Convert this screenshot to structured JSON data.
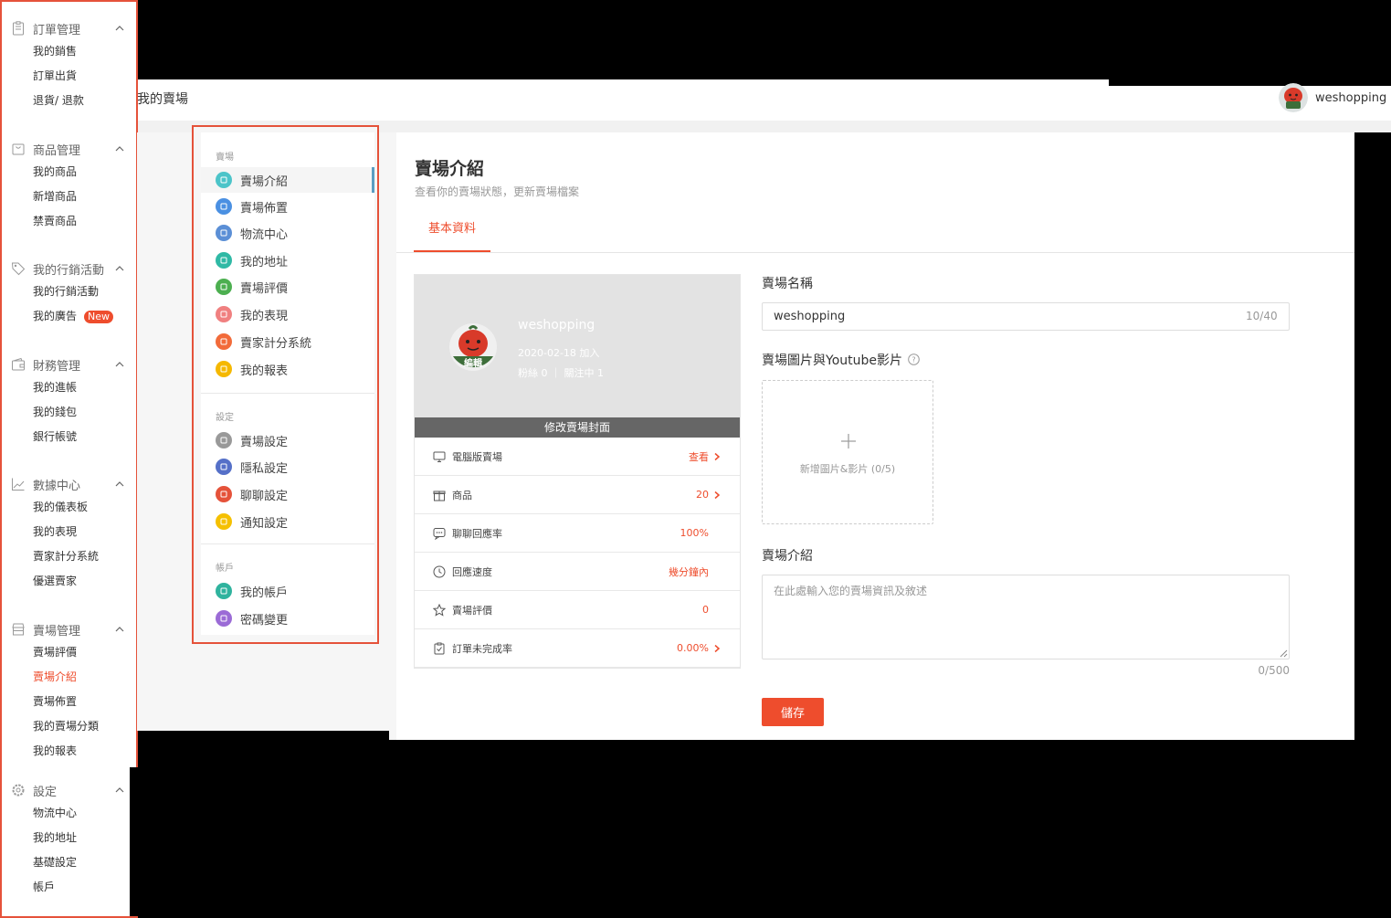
{
  "header": {
    "breadcrumb": "我的賣場",
    "username": "weshopping"
  },
  "left_nav": {
    "groups": [
      {
        "title": "訂單管理",
        "icon": "clipboard-icon",
        "items": [
          "我的銷售",
          "訂單出貨",
          "退貨/ 退款"
        ]
      },
      {
        "title": "商品管理",
        "icon": "bag-icon",
        "items": [
          "我的商品",
          "新增商品",
          "禁賣商品"
        ]
      },
      {
        "title": "我的行銷活動",
        "icon": "tag-icon",
        "items": [
          "我的行銷活動",
          "我的廣告"
        ]
      },
      {
        "title": "財務管理",
        "icon": "wallet-icon",
        "items": [
          "我的進帳",
          "我的錢包",
          "銀行帳號"
        ]
      },
      {
        "title": "數據中心",
        "icon": "chart-line-icon",
        "items": [
          "我的儀表板",
          "我的表現",
          "賣家計分系統",
          "優選賣家"
        ]
      },
      {
        "title": "賣場管理",
        "icon": "store-icon",
        "items": [
          "賣場評價",
          "賣場介紹",
          "賣場佈置",
          "我的賣場分類",
          "我的報表"
        ]
      },
      {
        "title": "設定",
        "icon": "gear-icon",
        "items": [
          "物流中心",
          "我的地址",
          "基礎設定",
          "帳戶"
        ]
      }
    ],
    "new_badge": "New",
    "active_item": "賣場介紹"
  },
  "settings_nav": {
    "sections": [
      {
        "label": "賣場",
        "items": [
          "賣場介紹",
          "賣場佈置",
          "物流中心",
          "我的地址",
          "賣場評價",
          "我的表現",
          "賣家計分系統",
          "我的報表"
        ]
      },
      {
        "label": "設定",
        "items": [
          "賣場設定",
          "隱私設定",
          "聊聊設定",
          "通知設定"
        ]
      },
      {
        "label": "帳戶",
        "items": [
          "我的帳戶",
          "密碼變更"
        ]
      }
    ],
    "icon_colors": {
      "賣場介紹": "#4cc4c9",
      "賣場佈置": "#4a90e2",
      "物流中心": "#5b8fd6",
      "我的地址": "#2fb9a5",
      "賣場評價": "#4caf50",
      "我的表現": "#f08080",
      "賣家計分系統": "#f26b3a",
      "我的報表": "#f5b800",
      "賣場設定": "#999999",
      "隱私設定": "#5570c8",
      "聊聊設定": "#e5523a",
      "通知設定": "#f5c000",
      "我的帳戶": "#2fb39e",
      "密碼變更": "#9b6bd6"
    }
  },
  "main": {
    "title": "賣場介紹",
    "subtitle": "查看你的賣場狀態，更新賣場檔案",
    "tab": "基本資料",
    "cover": {
      "shop_name": "weshopping",
      "joined": "2020-02-18 加入",
      "stats": "粉絲 0 ｜ 關注中 1",
      "avatar_label": "編輯",
      "edit_cover_button": "修改賣場封面"
    },
    "stats": [
      {
        "label": "電腦版賣場",
        "value": "查看",
        "icon": "monitor-icon",
        "has_arrow": true
      },
      {
        "label": "商品",
        "value": "20",
        "icon": "gift-box-icon",
        "has_arrow": true
      },
      {
        "label": "聊聊回應率",
        "value": "100%",
        "icon": "chat-bubble-icon",
        "has_arrow": false
      },
      {
        "label": "回應速度",
        "value": "幾分鐘內",
        "icon": "clock-icon",
        "has_arrow": false
      },
      {
        "label": "賣場評價",
        "value": "0",
        "icon": "star-icon",
        "has_arrow": false
      },
      {
        "label": "訂單未完成率",
        "value": "0.00%",
        "icon": "clipboard-check-icon",
        "has_arrow": true
      }
    ],
    "form": {
      "shop_name_label": "賣場名稱",
      "shop_name_value": "weshopping",
      "shop_name_count": "10/40",
      "media_label": "賣場圖片與Youtube影片",
      "media_upload_text": "新增圖片&影片 (0/5)",
      "intro_label": "賣場介紹",
      "intro_placeholder": "在此處輸入您的賣場資訊及敘述",
      "intro_count": "0/500",
      "save_label": "儲存"
    }
  },
  "colors": {
    "accent": "#ee4d2d",
    "callout": "#e5523a"
  }
}
